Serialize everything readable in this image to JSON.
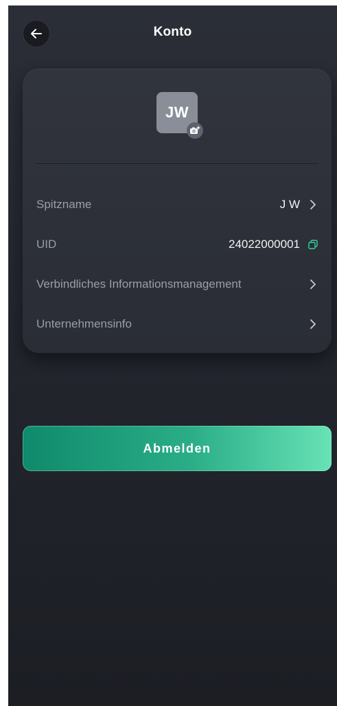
{
  "header": {
    "title": "Konto",
    "back_icon": "arrow-left-icon"
  },
  "profile": {
    "avatar_initials": "JW",
    "avatar_color": "#8a8e98",
    "camera_icon": "camera-plus-icon"
  },
  "rows": [
    {
      "label": "Spitzname",
      "value": "J W",
      "action_icon": "chevron-right-icon"
    },
    {
      "label": "UID",
      "value": "24022000001",
      "action_icon": "copy-icon"
    },
    {
      "label": "Verbindliches Informationsmanagement",
      "value": "",
      "action_icon": "chevron-right-icon"
    },
    {
      "label": "Unternehmensinfo",
      "value": "",
      "action_icon": "chevron-right-icon"
    }
  ],
  "logout": {
    "label": "Abmelden"
  },
  "colors": {
    "background": "#23262e",
    "card": "#2e3139",
    "accent_green": "#2bae88",
    "copy_icon": "#35d3a0"
  }
}
